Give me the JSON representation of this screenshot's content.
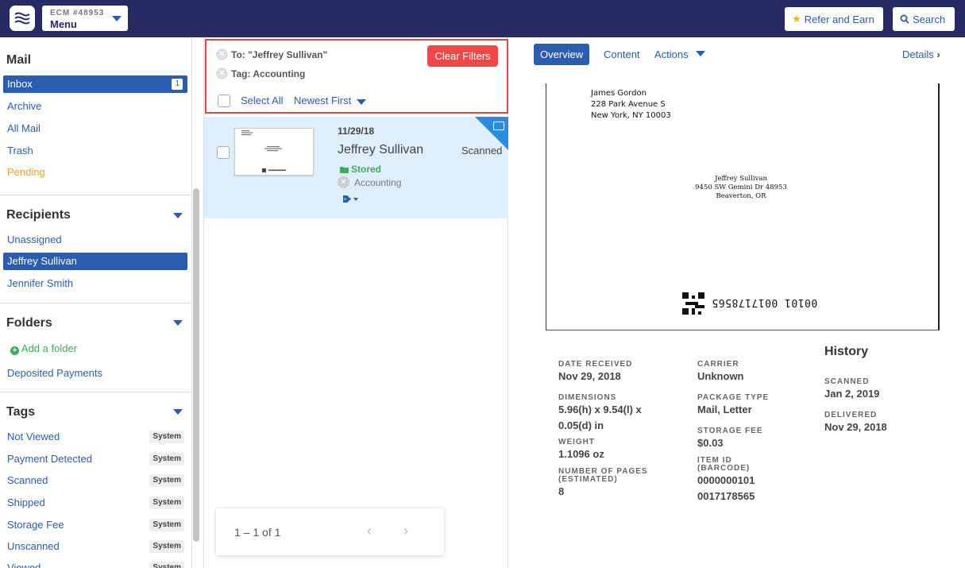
{
  "header": {
    "account_id": "ECM #48953",
    "menu_label": "Menu",
    "refer_label": "Refer and Earn",
    "search_label": "Search"
  },
  "sidebar": {
    "mail_title": "Mail",
    "mail_items": [
      {
        "label": "Inbox",
        "count": "1",
        "active": true
      },
      {
        "label": "Archive"
      },
      {
        "label": "All Mail"
      },
      {
        "label": "Trash"
      },
      {
        "label": "Pending"
      }
    ],
    "recipients_title": "Recipients",
    "recipients": [
      {
        "label": "Unassigned"
      },
      {
        "label": "Jeffrey Sullivan",
        "active": true
      },
      {
        "label": "Jennifer Smith"
      }
    ],
    "folders_title": "Folders",
    "add_folder_label": "Add a folder",
    "folders": [
      {
        "label": "Deposited Payments"
      }
    ],
    "tags_title": "Tags",
    "tags": [
      {
        "label": "Not Viewed",
        "badge": "System"
      },
      {
        "label": "Payment Detected",
        "badge": "System"
      },
      {
        "label": "Scanned",
        "badge": "System"
      },
      {
        "label": "Shipped",
        "badge": "System"
      },
      {
        "label": "Storage Fee",
        "badge": "System"
      },
      {
        "label": "Unscanned",
        "badge": "System"
      },
      {
        "label": "Viewed",
        "badge": "System"
      }
    ]
  },
  "filters": {
    "to_filter": "To: \"Jeffrey Sullivan\"",
    "tag_filter": "Tag: Accounting",
    "clear_label": "Clear Filters",
    "select_all_label": "Select All",
    "sort_label": "Newest First"
  },
  "mail_item": {
    "date": "11/29/18",
    "recipient": "Jeffrey Sullivan",
    "status": "Scanned",
    "folder": "Stored",
    "tag": "Accounting"
  },
  "pagination": {
    "range_text": "1 – 1 of 1"
  },
  "detail": {
    "tabs": {
      "overview": "Overview",
      "content": "Content",
      "actions": "Actions",
      "details": "Details"
    },
    "envelope": {
      "sender_name": "James Gordon",
      "sender_street": "228 Park Avenue S",
      "sender_city": "New York, NY 10003",
      "recipient_name": "Jeffrey Sullivan",
      "recipient_street": "9450 SW Gemini Dr 48953",
      "recipient_city": "Beaverton, OR",
      "barcode_text": "00101 0017178565"
    },
    "fields": {
      "date_received_label": "DATE RECEIVED",
      "date_received": "Nov 29, 2018",
      "dimensions_label": "DIMENSIONS",
      "dimensions_line1": "5.96(h) x 9.54(l) x",
      "dimensions_line2": "0.05(d) in",
      "weight_label": "WEIGHT",
      "weight": "1.1096 oz",
      "pages_label_line1": "NUMBER OF PAGES",
      "pages_label_line2": "(ESTIMATED)",
      "pages": "8",
      "carrier_label": "CARRIER",
      "carrier": "Unknown",
      "package_type_label": "PACKAGE TYPE",
      "package_type": "Mail, Letter",
      "storage_fee_label": "STORAGE FEE",
      "storage_fee": "$0.03",
      "item_id_label_line1": "ITEM ID",
      "item_id_label_line2": "(BARCODE)",
      "item_id_line1": "0000000101",
      "item_id_line2": "0017178565"
    },
    "history": {
      "title": "History",
      "scanned_label": "SCANNED",
      "scanned": "Jan 2, 2019",
      "delivered_label": "DELIVERED",
      "delivered": "Nov 29, 2018"
    }
  },
  "colors": {
    "topbar": "#262b63",
    "accent": "#2a5db0",
    "clear_button": "#f04848",
    "stored_green": "#3cae5a",
    "pending_orange": "#f0a030",
    "selected_item_bg": "#dfeefb"
  }
}
